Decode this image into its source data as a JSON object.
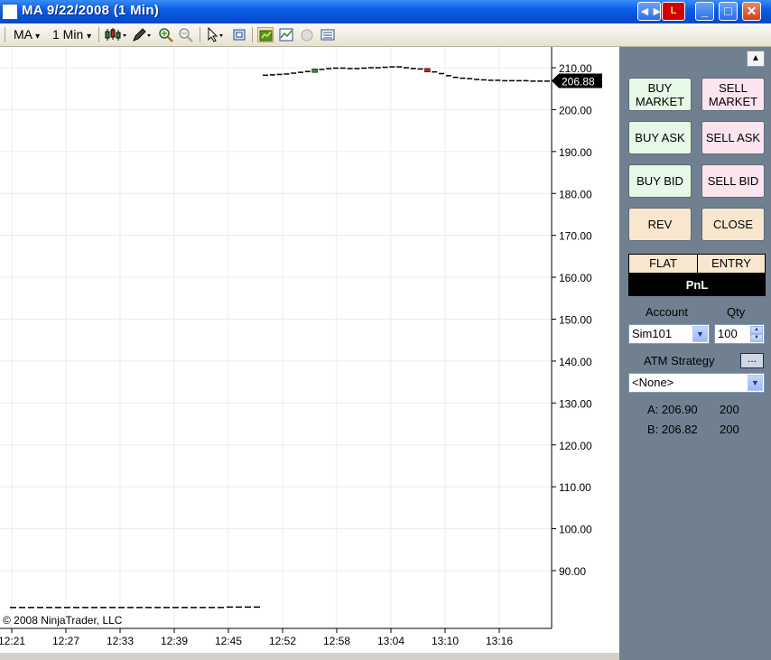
{
  "window": {
    "title": "MA  9/22/2008 (1 Min)",
    "nav_label": "◄►",
    "l_label": "L",
    "minimize_label": "_",
    "maximize_label": "□",
    "close_label": "✕"
  },
  "toolbar": {
    "instrument": "MA",
    "interval": "1 Min",
    "dropdown_arrow": "▾"
  },
  "chart": {
    "copyright": "© 2008 NinjaTrader, LLC",
    "last_price": "206.88",
    "y_ticks": [
      "210.00",
      "200.00",
      "190.00",
      "180.00",
      "170.00",
      "160.00",
      "150.00",
      "140.00",
      "130.00",
      "120.00",
      "110.00",
      "100.00",
      "90.00"
    ],
    "x_ticks": [
      "12:21",
      "12:27",
      "12:33",
      "12:39",
      "12:45",
      "12:52",
      "12:58",
      "13:04",
      "13:10",
      "13:16"
    ],
    "colors": {
      "up": "#2e8b2e",
      "down": "#c02020",
      "bar": "#000000",
      "grid": "#efece6"
    }
  },
  "chart_data": {
    "type": "candlestick",
    "x_ticks": [
      "12:21",
      "12:27",
      "12:33",
      "12:39",
      "12:45",
      "12:52",
      "12:58",
      "13:04",
      "13:10",
      "13:16"
    ],
    "ylim": [
      80,
      212
    ],
    "last_price": 206.88,
    "series": [
      {
        "values": [
          81.2,
          81.2,
          81.2,
          81.2,
          81.2,
          81.2,
          81.2,
          81.2,
          81.2,
          81.2,
          81.2,
          81.2,
          81.2,
          81.2,
          81.2,
          81.2,
          81.2,
          81.2,
          81.2,
          81.2,
          81.2,
          81.2,
          81.2,
          81.2,
          81.3,
          81.3,
          81.3,
          81.3
        ]
      },
      {
        "values": [
          208.2,
          208.3,
          208.4,
          208.5,
          208.7,
          208.9,
          209.1,
          209.3,
          209.6,
          209.8,
          209.9,
          209.9,
          209.8,
          209.8,
          209.9,
          210.0,
          210.0,
          210.1,
          210.2,
          210.2,
          210.0,
          209.8,
          209.7,
          209.4,
          209.0,
          208.6,
          208.1,
          207.7,
          207.5,
          207.4,
          207.2,
          207.1,
          207.0,
          207.0,
          206.9,
          206.9,
          206.9,
          206.9,
          206.8,
          206.8,
          206.8,
          206.9
        ]
      }
    ]
  },
  "order_panel": {
    "scroll_arrow": "▲",
    "buy_market": "BUY MARKET",
    "sell_market": "SELL MARKET",
    "buy_ask": "BUY ASK",
    "sell_ask": "SELL ASK",
    "buy_bid": "BUY BID",
    "sell_bid": "SELL BID",
    "rev": "REV",
    "close": "CLOSE",
    "position": "FLAT",
    "entry": "ENTRY",
    "pnl": "PnL",
    "account_label": "Account",
    "qty_label": "Qty",
    "account_value": "Sim101",
    "qty_value": "100",
    "atm_label": "ATM Strategy",
    "atm_button": "...",
    "atm_value": "<None>",
    "ask_label": "A: 206.90",
    "ask_size": "200",
    "bid_label": "B: 206.82",
    "bid_size": "200",
    "dropdown_arrow": "▼",
    "spin_up": "▲",
    "spin_down": "▼"
  }
}
